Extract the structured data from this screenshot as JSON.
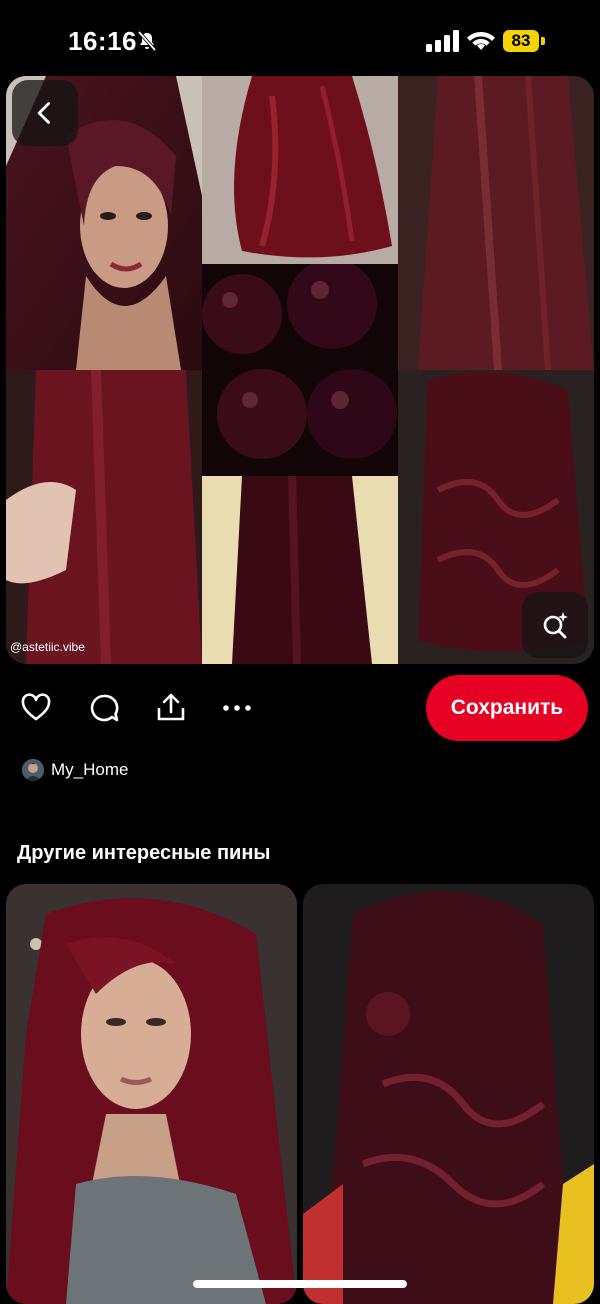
{
  "status_bar": {
    "time": "16:16",
    "battery": "83",
    "icons": [
      "bell-slash-icon",
      "cellular-signal-icon",
      "wifi-icon",
      "battery-icon"
    ]
  },
  "pin": {
    "watermark": "@astetiic.vibe",
    "images": [
      "woman-burgundy-hair",
      "burgundy-hair-back-wavy",
      "long-straight-cherry-hair",
      "dark-cherries",
      "hand-touching-straight-hair",
      "straight-hair-back",
      "long-wavy-burgundy-hair"
    ]
  },
  "actions": {
    "icons": [
      "heart-icon",
      "comment-icon",
      "share-icon",
      "more-icon"
    ],
    "save_label": "Сохранить",
    "colors": {
      "save": "#e60023"
    }
  },
  "author": {
    "name": "My_Home"
  },
  "more_pins": {
    "title": "Другие интересные пины",
    "items": [
      "woman-wavy-burgundy-hair",
      "burgundy-half-up-knot-hair"
    ]
  }
}
